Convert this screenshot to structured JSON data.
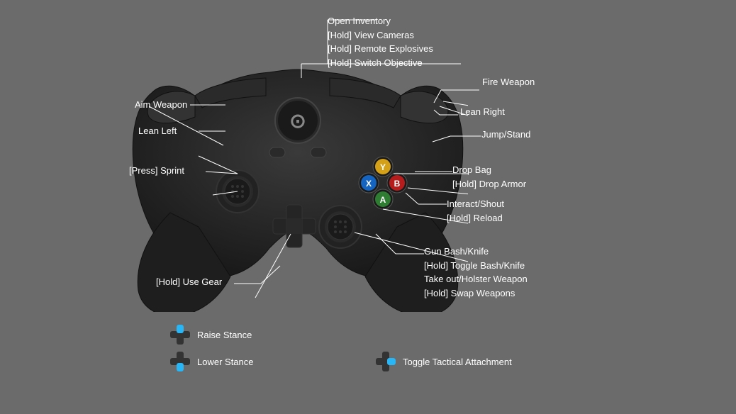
{
  "background": "#6b6b6b",
  "labels": {
    "open_inventory": "Open Inventory",
    "hold_view_cameras": "[Hold] View Cameras",
    "hold_remote_explosives": "[Hold] Remote Explosives",
    "hold_switch_objective": "[Hold] Switch Objective",
    "fire_weapon": "Fire Weapon",
    "lean_right": "Lean Right",
    "jump_stand": "Jump/Stand",
    "aim_weapon": "Aim Weapon",
    "lean_left": "Lean Left",
    "press_sprint": "[Press] Sprint",
    "drop_bag": "Drop Bag",
    "hold_drop_armor": "[Hold] Drop Armor",
    "interact_shout": "Interact/Shout",
    "hold_reload": "[Hold] Reload",
    "gun_bash_knife": "Gun Bash/Knife",
    "hold_toggle_bash": "[Hold] Toggle Bash/Knife",
    "take_out_holster": "Take out/Holster Weapon",
    "hold_swap_weapons": "[Hold] Swap Weapons",
    "hold_use_gear": "[Hold] Use Gear",
    "raise_stance": "Raise Stance",
    "lower_stance": "Lower Stance",
    "toggle_tactical": "Toggle Tactical Attachment"
  },
  "buttons": {
    "Y": {
      "color": "#f5c518",
      "label": "Y"
    },
    "X": {
      "color": "#4fc3f7",
      "label": "X"
    },
    "B": {
      "color": "#ef5350",
      "label": "B"
    },
    "A": {
      "color": "#66bb6a",
      "label": "A"
    }
  },
  "colors": {
    "dpad_blue": "#29b6f6",
    "controller": "#1a1a1a",
    "line": "#ffffff"
  }
}
